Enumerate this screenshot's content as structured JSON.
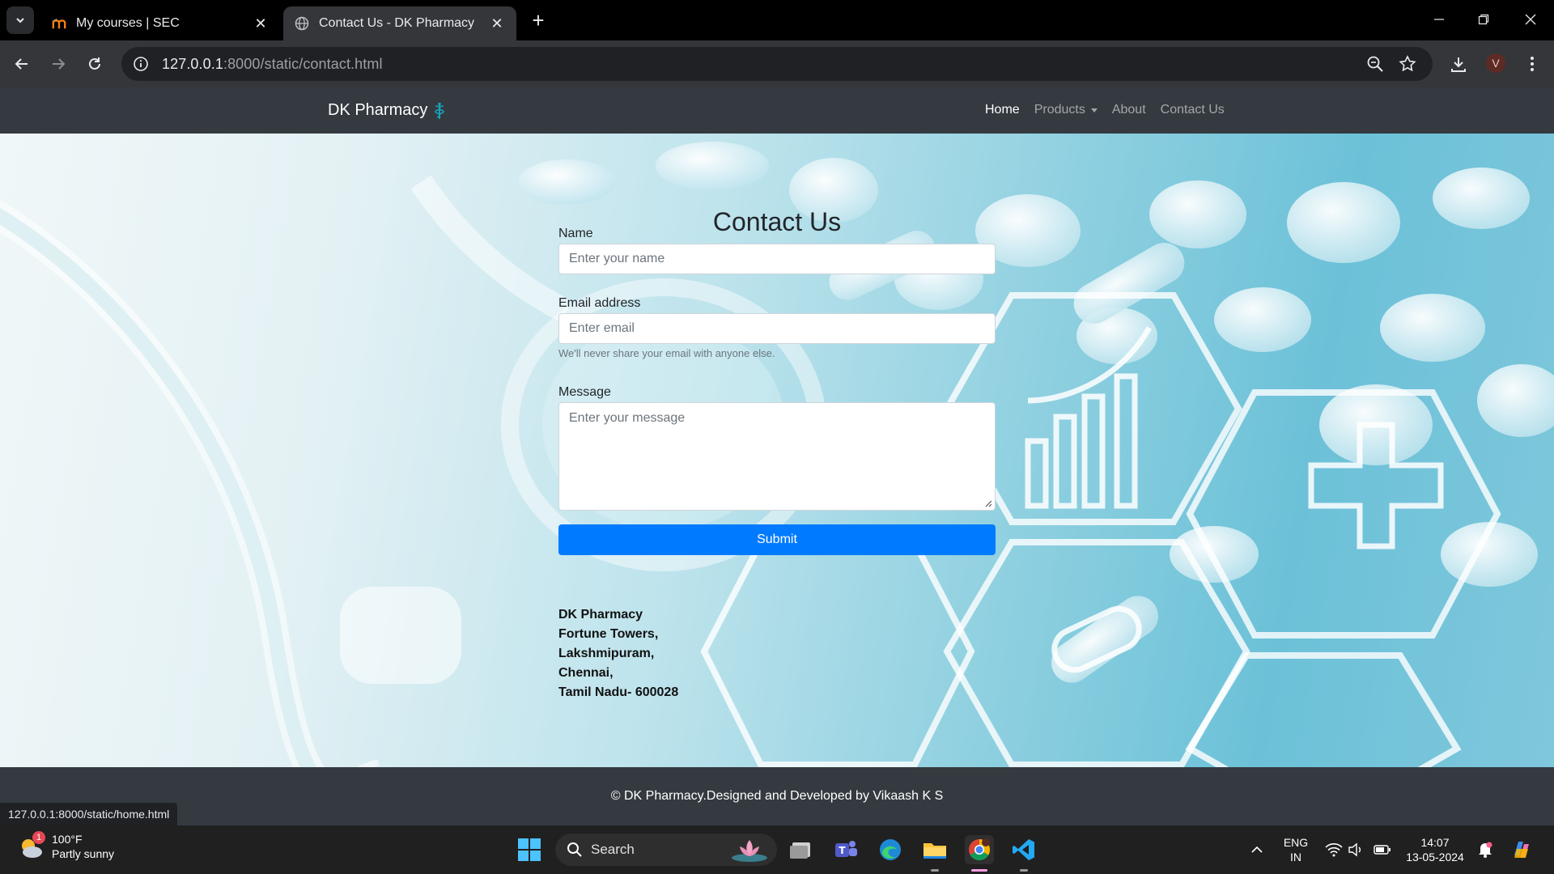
{
  "browser": {
    "tabs": [
      {
        "title": "My courses | SEC",
        "active": false
      },
      {
        "title": "Contact Us - DK Pharmacy",
        "active": true
      }
    ],
    "url_host": "127.0.0.1",
    "url_path": ":8000/static/contact.html",
    "profile_initial": "V",
    "status_url": "127.0.0.1:8000/static/home.html"
  },
  "site": {
    "brand": "DK Pharmacy",
    "nav": [
      {
        "label": "Home",
        "active": true
      },
      {
        "label": "Products",
        "dropdown": true
      },
      {
        "label": "About"
      },
      {
        "label": "Contact Us"
      }
    ],
    "page_title": "Contact Us",
    "form": {
      "name_label": "Name",
      "name_placeholder": "Enter your name",
      "email_label": "Email address",
      "email_placeholder": "Enter email",
      "email_help": "We'll never share your email with anyone else.",
      "message_label": "Message",
      "message_placeholder": "Enter your message",
      "submit_label": "Submit"
    },
    "address": {
      "line1": "DK Pharmacy",
      "line2": "Fortune Towers,",
      "line3": "Lakshmipuram,",
      "line4": "Chennai,",
      "line5": "Tamil Nadu- 600028"
    },
    "footer": "© DK Pharmacy.Designed and Developed by Vikaash K S"
  },
  "taskbar": {
    "weather_badge": "1",
    "weather_temp": "100°F",
    "weather_desc": "Partly sunny",
    "search_label": "Search",
    "lang_top": "ENG",
    "lang_bottom": "IN",
    "time": "14:07",
    "date": "13-05-2024"
  },
  "colors": {
    "site_nav": "#343a40",
    "submit": "#007bff",
    "chrome_active_tab": "#35363a",
    "taskbar": "#202020"
  }
}
